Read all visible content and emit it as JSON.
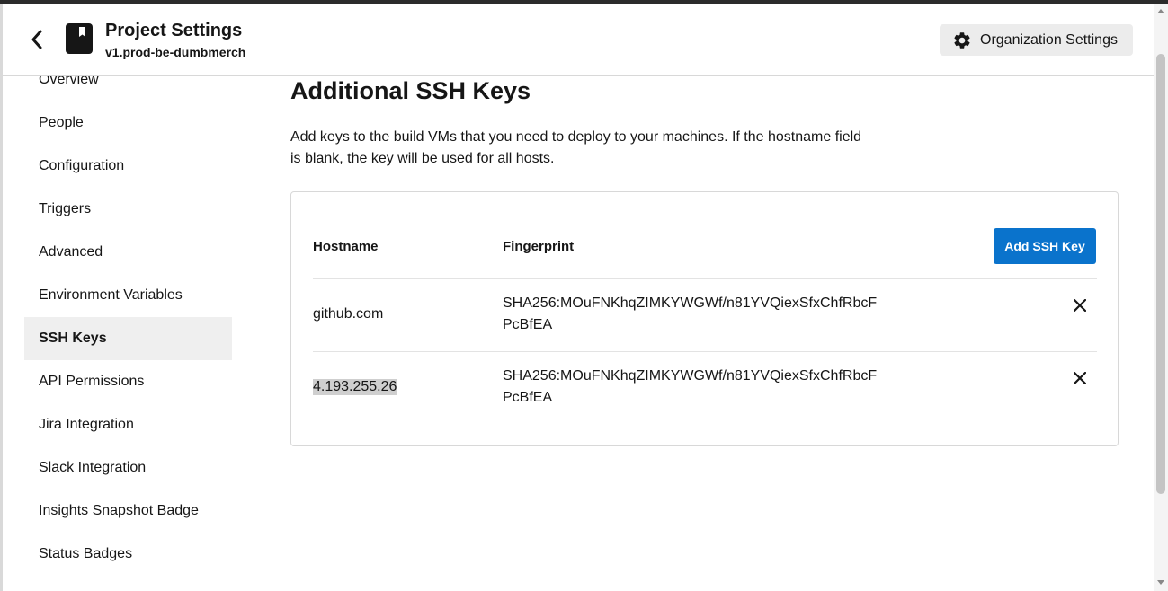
{
  "header": {
    "title": "Project Settings",
    "subtitle": "v1.prod-be-dumbmerch",
    "org_button_label": "Organization Settings"
  },
  "sidebar": {
    "items": [
      {
        "label": "Overview",
        "active": false
      },
      {
        "label": "People",
        "active": false
      },
      {
        "label": "Configuration",
        "active": false
      },
      {
        "label": "Triggers",
        "active": false
      },
      {
        "label": "Advanced",
        "active": false
      },
      {
        "label": "Environment Variables",
        "active": false
      },
      {
        "label": "SSH Keys",
        "active": true
      },
      {
        "label": "API Permissions",
        "active": false
      },
      {
        "label": "Jira Integration",
        "active": false
      },
      {
        "label": "Slack Integration",
        "active": false
      },
      {
        "label": "Insights Snapshot Badge",
        "active": false
      },
      {
        "label": "Status Badges",
        "active": false
      }
    ]
  },
  "main": {
    "title": "Additional SSH Keys",
    "description": "Add keys to the build VMs that you need to deploy to your machines. If the hostname field is blank, the key will be used for all hosts.",
    "table": {
      "columns": [
        "Hostname",
        "Fingerprint"
      ],
      "add_button_label": "Add SSH Key",
      "rows": [
        {
          "hostname": "github.com",
          "fingerprint": "SHA256:MOuFNKhqZIMKYWGWf/n81YVQiexSfxChfRbcFPcBfEA"
        },
        {
          "hostname": "4.193.255.26",
          "fingerprint": "SHA256:MOuFNKhqZIMKYWGWf/n81YVQiexSfxChfRbcFPcBfEA"
        }
      ]
    }
  },
  "colors": {
    "accent": "#0a73cc",
    "active_nav_bg": "#efefef"
  },
  "icons": {
    "back": "chevron-left-icon",
    "project": "bookmark-icon",
    "settings": "gear-icon",
    "delete": "close-icon"
  }
}
